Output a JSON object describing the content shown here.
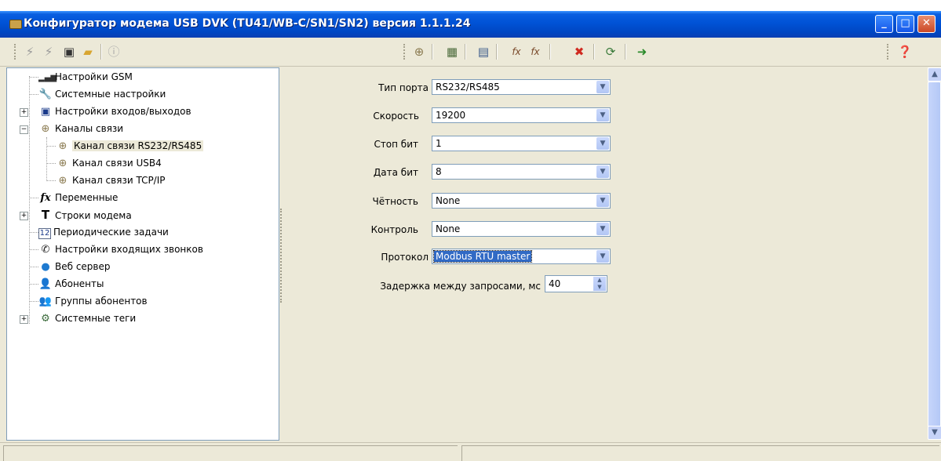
{
  "window": {
    "title": "Конфигуратор модема USB DVK (TU41/WB-C/SN1/SN2)  версия 1.1.1.24",
    "controls": {
      "minimize": "_",
      "maximize": "□",
      "close": "✕"
    }
  },
  "toolbar": {
    "left_icons": [
      "connect-icon",
      "disconnect-icon",
      "save-icon",
      "open-folder-icon",
      "info-icon"
    ],
    "middle_icons": [
      "port-icon",
      "module-icon",
      "calendar-icon",
      "add-variable-icon",
      "edit-variable-icon",
      "delete-icon",
      "refresh-icon",
      "import-icon"
    ],
    "help_icon": "help-icon"
  },
  "tree": {
    "items": [
      {
        "label": "Настройки GSM",
        "icon": "signal-icon"
      },
      {
        "label": "Системные настройки",
        "icon": "wrench-icon"
      },
      {
        "label": "Настройки входов/выходов",
        "icon": "monitor-icon",
        "expander": "+"
      },
      {
        "label": "Каналы связи",
        "icon": "plug-icon",
        "expander": "−"
      },
      {
        "label": "Канал связи RS232/RS485",
        "icon": "plug-icon",
        "selected": true
      },
      {
        "label": "Канал связи USB4",
        "icon": "plug-icon"
      },
      {
        "label": "Канал связи TCP/IP",
        "icon": "plug-icon"
      },
      {
        "label": "Переменные",
        "icon": "fx-icon"
      },
      {
        "label": "Строки модема",
        "icon": "text-cursor-icon",
        "expander": "+"
      },
      {
        "label": "Периодические задачи",
        "icon": "calendar-icon"
      },
      {
        "label": "Настройки входящих звонков",
        "icon": "phone-icon"
      },
      {
        "label": "Веб сервер",
        "icon": "globe-icon"
      },
      {
        "label": "Абоненты",
        "icon": "user-icon"
      },
      {
        "label": "Группы абонентов",
        "icon": "users-icon"
      },
      {
        "label": "Системные теги",
        "icon": "tags-icon",
        "expander": "+"
      }
    ]
  },
  "form": {
    "port_type": {
      "label": "Тип порта",
      "value": "RS232/RS485"
    },
    "speed": {
      "label": "Скорость",
      "value": "19200"
    },
    "stop_bits": {
      "label": "Стоп бит",
      "value": "1"
    },
    "data_bits": {
      "label": "Дата бит",
      "value": "8"
    },
    "parity": {
      "label": "Чётность",
      "value": "None"
    },
    "control": {
      "label": "Контроль",
      "value": "None"
    },
    "protocol": {
      "label": "Протокол",
      "value": "Modbus RTU master"
    },
    "delay": {
      "label": "Задержка между запросами, мс",
      "value": "40"
    }
  },
  "colors": {
    "titlebar": "#0052D6",
    "face": "#ECE9D8",
    "selection": "#316AC5"
  }
}
